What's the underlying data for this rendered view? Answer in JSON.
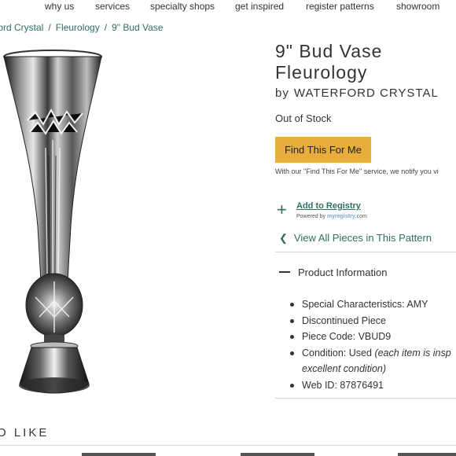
{
  "nav": {
    "items": [
      "why us",
      "services",
      "specialty shops",
      "get inspired",
      "register patterns",
      "showroom"
    ]
  },
  "breadcrumb": {
    "items": [
      "ford Crystal",
      "Fleurology",
      "9\" Bud Vase"
    ],
    "separator": "/"
  },
  "product": {
    "title_line1": "9\" Bud Vase",
    "title_line2": "Fleurology",
    "by_label": "by",
    "brand": "WATERFORD CRYSTAL",
    "stock_status": "Out of Stock",
    "find_button": "Find This For Me",
    "find_note": "With our \"Find This For Me\" service, we notify you vi"
  },
  "registry": {
    "add_label": "Add to Registry",
    "powered_by": "Powered by",
    "powered_brand": "myregistry",
    "powered_suffix": ".com"
  },
  "pattern": {
    "view_all": "View All Pieces in This Pattern"
  },
  "product_info": {
    "heading": "Product Information",
    "special": "Special Characteristics: AMY",
    "discontinued": "Discontinued Piece",
    "piece_code": "Piece Code: VBUD9",
    "condition_label": "Condition: Used",
    "condition_note": "(each item is insp excellent condition)",
    "web_id": "Web ID: 87876491"
  },
  "like": {
    "heading": "O LIKE"
  },
  "colors": {
    "accent_green": "#2f6e63",
    "button_gold": "#e8ad3c"
  },
  "icons": [
    "plus-icon",
    "chevron-left-icon",
    "minus-icon"
  ]
}
